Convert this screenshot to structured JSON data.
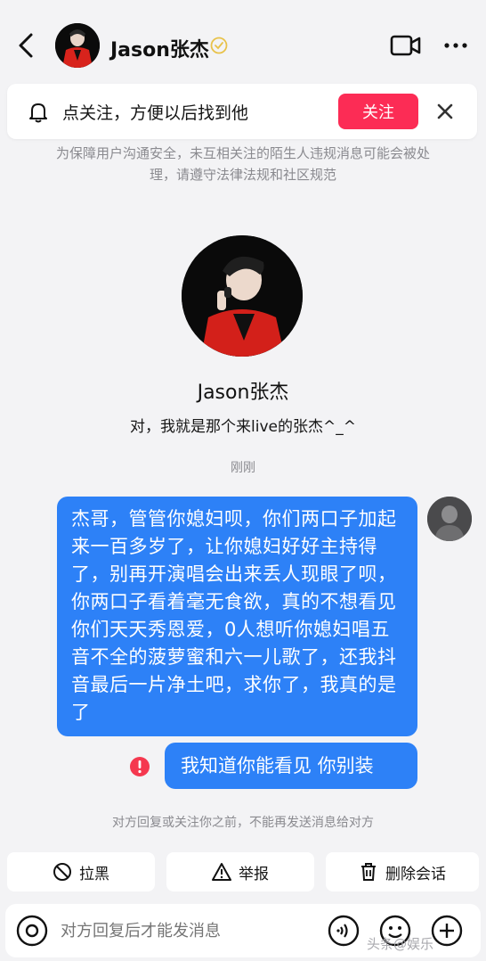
{
  "header": {
    "contact_name": "Jason张杰",
    "verified_icon": "verified-badge-icon"
  },
  "follow_banner": {
    "text": "点关注，方便以后找到他",
    "follow_label": "关注",
    "accent": "#fc2c55"
  },
  "safety_note": "为保障用户沟通安全，未互相关注的陌生人违规消息可能会被处理，请遵守法律法规和社区规范",
  "profile": {
    "name": "Jason张杰",
    "bio": "对，我就是那个来live的张杰^_^"
  },
  "timestamp": "刚刚",
  "messages": [
    {
      "sender": "me",
      "text": "杰哥，管管你媳妇呗，你们两口子加起来一百多岁了，让你媳妇好好主持得了，别再开演唱会出来丢人现眼了呗，你两口子看着毫无食欲，真的不想看见你们天天秀恩爱，0人想听你媳妇唱五音不全的菠萝蜜和六一儿歌了，还我抖音最后一片净土吧，求你了，我真的是了"
    },
    {
      "sender": "me",
      "text": "我知道你能看见 你别装",
      "status": "failed"
    }
  ],
  "bubble_color": "#2d81f7",
  "blocked_note": "对方回复或关注你之前，不能再发送消息给对方",
  "actions": {
    "block": "拉黑",
    "report": "举报",
    "delete": "删除会话"
  },
  "input": {
    "placeholder": "对方回复后才能发消息"
  },
  "watermark": "头条@娱乐"
}
